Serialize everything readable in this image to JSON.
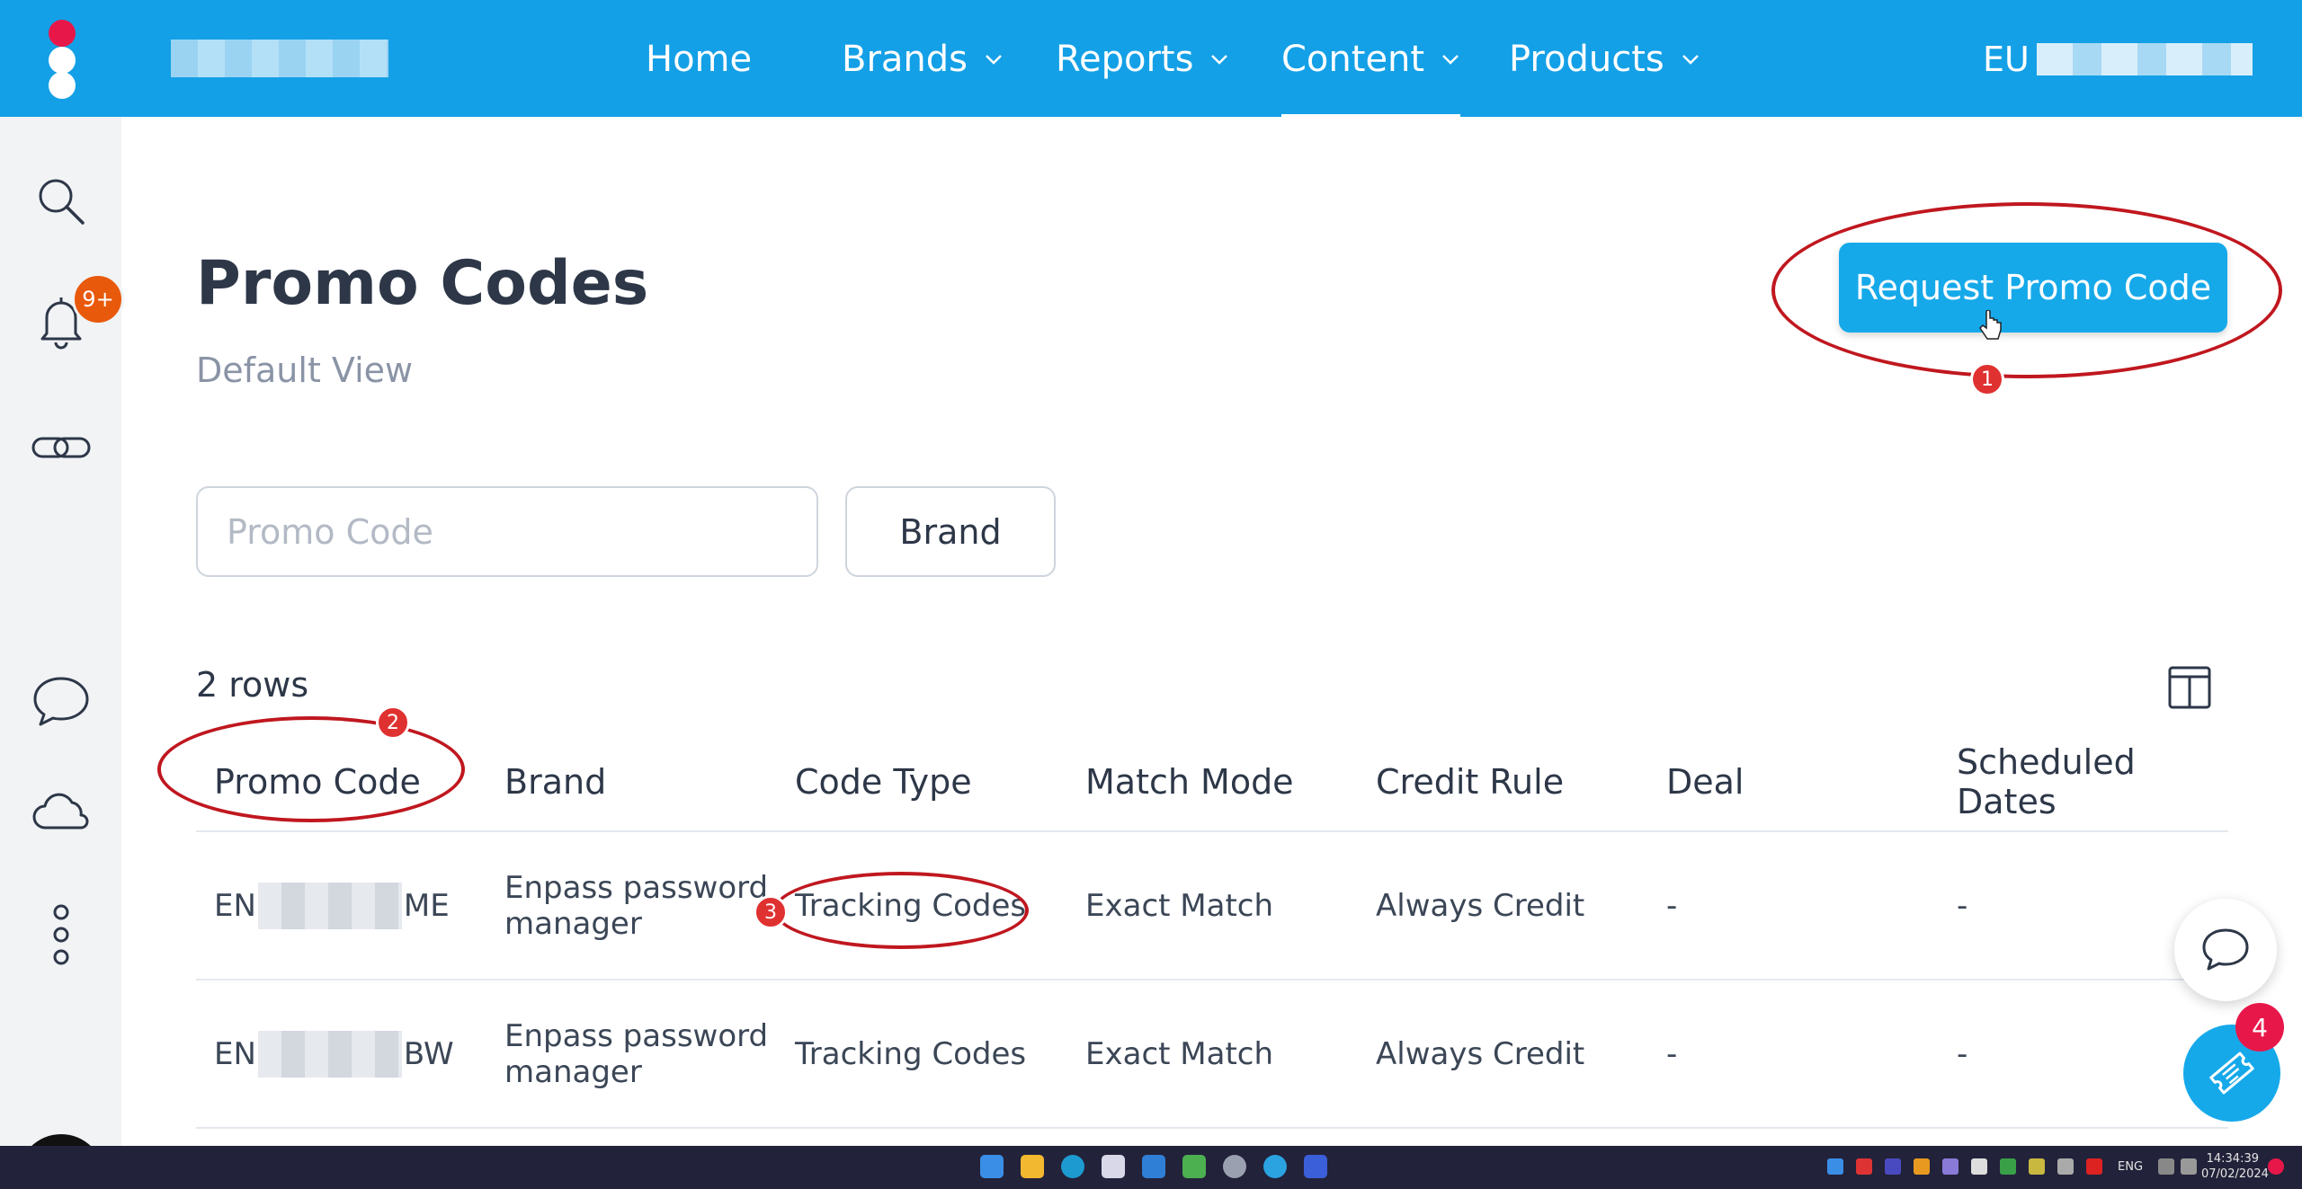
{
  "nav": {
    "items": [
      {
        "label": "Home"
      },
      {
        "label": "Brands"
      },
      {
        "label": "Reports"
      },
      {
        "label": "Content"
      },
      {
        "label": "Products"
      }
    ],
    "user_prefix": "EU"
  },
  "sidebar": {
    "notification_badge": "9+"
  },
  "page": {
    "title": "Promo Codes",
    "subtitle": "Default View",
    "request_button_label": "Request Promo Code"
  },
  "filters": {
    "promo_placeholder": "Promo Code",
    "brand_label": "Brand"
  },
  "table": {
    "row_count_label": "2 rows",
    "headers": [
      "Promo Code",
      "Brand",
      "Code Type",
      "Match Mode",
      "Credit Rule",
      "Deal",
      "Scheduled Dates"
    ],
    "rows": [
      {
        "code_prefix": "EN",
        "code_suffix": "ME",
        "brand": "Enpass password manager",
        "code_type": "Tracking Codes",
        "match_mode": "Exact Match",
        "credit_rule": "Always Credit",
        "deal": "-",
        "scheduled_dates": "-"
      },
      {
        "code_prefix": "EN",
        "code_suffix": "BW",
        "brand": "Enpass password manager",
        "code_type": "Tracking Codes",
        "match_mode": "Exact Match",
        "credit_rule": "Always Credit",
        "deal": "-",
        "scheduled_dates": "-"
      }
    ]
  },
  "annotations": {
    "m1": "1",
    "m2": "2",
    "m3": "3"
  },
  "fab": {
    "ticket_badge": "4"
  },
  "taskbar": {
    "lang": "ENG",
    "time": "14:34:39",
    "date": "07/02/2024"
  },
  "colors": {
    "nav_bg": "#14a0e6",
    "accent_button": "#16a9ea",
    "annotation_red": "#c0171f",
    "badge_orange": "#e8590c"
  }
}
